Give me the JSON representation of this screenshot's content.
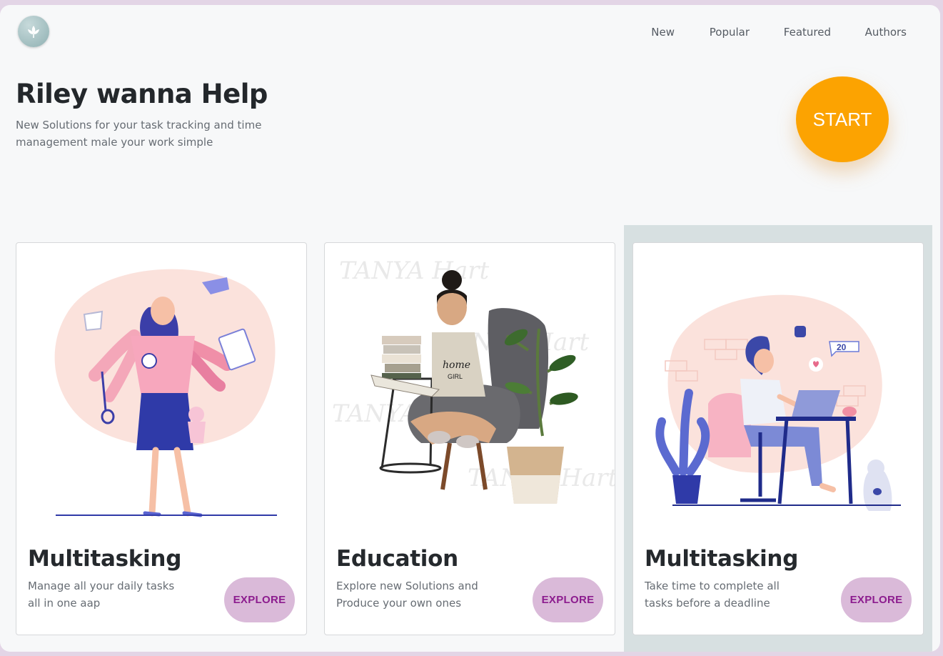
{
  "nav": {
    "logo_icon": "leaf-logo-icon",
    "items": [
      {
        "label": "New"
      },
      {
        "label": "Popular"
      },
      {
        "label": "Featured"
      },
      {
        "label": "Authors"
      }
    ]
  },
  "hero": {
    "title": "Riley wanna Help",
    "subtitle": "New Solutions for your task tracking and time management male your work simple",
    "start_label": "START"
  },
  "colors": {
    "accent": "#fca301",
    "explore_bg": "#dabad9",
    "explore_text": "#8c1c8e",
    "highlight_panel": "#d7e0e1"
  },
  "cards": [
    {
      "title": "Multitasking",
      "description": "Manage all your daily tasks all in one aap",
      "button_label": "EXPLORE",
      "illustration": "multitasking-woman-illustration"
    },
    {
      "title": "Education",
      "description": "Explore new Solutions and Produce your own ones",
      "button_label": "EXPLORE",
      "illustration": "reading-woman-illustration",
      "watermark_text": "TANYA Hart"
    },
    {
      "title": "Multitasking",
      "description": "Take time to complete all tasks before a deadline",
      "button_label": "EXPLORE",
      "illustration": "woman-laptop-illustration",
      "badge_count": "20"
    }
  ]
}
